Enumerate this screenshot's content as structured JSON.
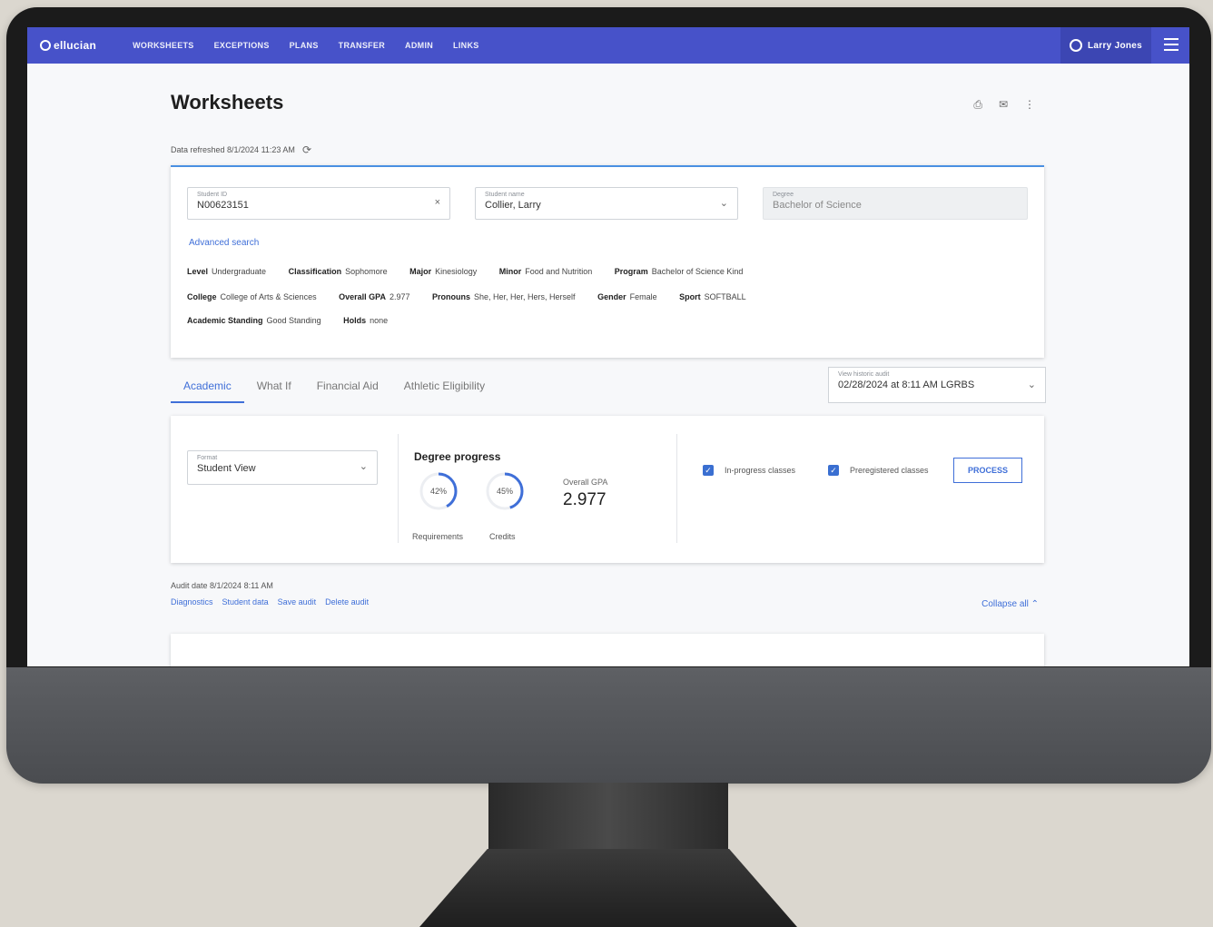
{
  "brand": "ellucian",
  "nav": {
    "items": [
      "WORKSHEETS",
      "EXCEPTIONS",
      "PLANS",
      "TRANSFER",
      "ADMIN",
      "LINKS"
    ],
    "user_name": "Larry Jones"
  },
  "page": {
    "title": "Worksheets",
    "refreshed": "Data refreshed 8/1/2024 11:23 AM"
  },
  "student": {
    "id_label": "Student ID",
    "id_value": "N00623151",
    "name_label": "Student name",
    "name_value": "Collier, Larry",
    "degree_label": "Degree",
    "degree_value": "Bachelor of Science",
    "advanced_search": "Advanced search",
    "attributes": [
      [
        {
          "label": "Level",
          "value": "Undergraduate"
        },
        {
          "label": "Classification",
          "value": "Sophomore"
        },
        {
          "label": "Major",
          "value": "Kinesiology"
        },
        {
          "label": "Minor",
          "value": "Food and Nutrition"
        },
        {
          "label": "Program",
          "value": "Bachelor of Science Kind"
        }
      ],
      [
        {
          "label": "College",
          "value": "College of Arts & Sciences"
        },
        {
          "label": "Overall GPA",
          "value": "2.977"
        },
        {
          "label": "Pronouns",
          "value": "She, Her, Her, Hers, Herself"
        },
        {
          "label": "Gender",
          "value": "Female"
        },
        {
          "label": "Sport",
          "value": "SOFTBALL"
        }
      ],
      [
        {
          "label": "Academic Standing",
          "value": "Good Standing"
        },
        {
          "label": "Holds",
          "value": "none"
        }
      ]
    ]
  },
  "tabs": [
    "Academic",
    "What If",
    "Financial Aid",
    "Athletic Eligibility"
  ],
  "view_select": {
    "label": "View historic audit",
    "value": "02/28/2024 at 8:11 AM LGRBS"
  },
  "progress": {
    "format_label": "Format",
    "format_value": "Student View",
    "title": "Degree progress",
    "requirements_pct": "42%",
    "requirements_fraction": 0.42,
    "requirements_label": "Requirements",
    "credits_pct": "45%",
    "credits_fraction": 0.45,
    "credits_label": "Credits",
    "gpa_label": "Overall GPA",
    "gpa_value": "2.977",
    "check_inprogress": "In-progress classes",
    "check_preregistered": "Preregistered classes",
    "process_label": "PROCESS"
  },
  "audit": {
    "date": "Audit date 8/1/2024 8:11 AM",
    "links": [
      "Diagnostics",
      "Student data",
      "Save audit",
      "Delete audit"
    ],
    "collapse": "Collapse all"
  },
  "colors": {
    "nav": "#4752c9",
    "accent": "#3f6fd8"
  }
}
